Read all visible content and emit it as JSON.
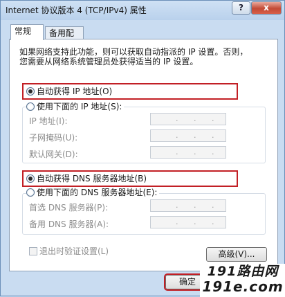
{
  "window": {
    "title": "Internet 协议版本 4 (TCP/IPv4) 属性",
    "help_label": "?",
    "close_label": "x"
  },
  "tabs": [
    {
      "label": "常规",
      "active": true
    },
    {
      "label": "备用配置",
      "active": false
    }
  ],
  "description": {
    "line1": "如果网络支持此功能，则可以获取自动指派的 IP 设置。否则，",
    "line2": "您需要从网络系统管理员处获得适当的 IP 设置。"
  },
  "ip_section": {
    "auto_label": "自动获得 IP 地址(O)",
    "auto_selected": true,
    "manual_label": "使用下面的 IP 地址(S):",
    "fields": [
      {
        "label": "IP 地址(I):",
        "value": ". . ."
      },
      {
        "label": "子网掩码(U):",
        "value": ". . ."
      },
      {
        "label": "默认网关(D):",
        "value": ". . ."
      }
    ]
  },
  "dns_section": {
    "auto_label": "自动获得 DNS 服务器地址(B)",
    "auto_selected": true,
    "manual_label": "使用下面的 DNS 服务器地址(E):",
    "fields": [
      {
        "label": "首选 DNS 服务器(P):",
        "value": ". . ."
      },
      {
        "label": "备用 DNS 服务器(A):",
        "value": ". . ."
      }
    ]
  },
  "validate_checkbox": {
    "label": "退出时验证设置(L)",
    "checked": false
  },
  "buttons": {
    "advanced": "高级(V)...",
    "ok": "确定"
  },
  "watermark": {
    "line1": "191路由网",
    "line2": "191e.com"
  },
  "colors": {
    "highlight_box": "#c21f25",
    "dialog_blue": "#c9dcf1"
  }
}
